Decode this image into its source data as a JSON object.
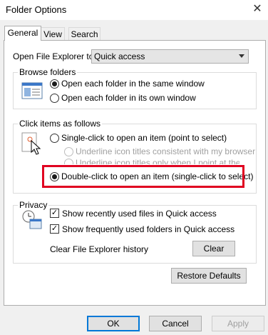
{
  "window": {
    "title": "Folder Options",
    "close_glyph": "✕"
  },
  "tabs": [
    "General",
    "View",
    "Search"
  ],
  "open_explorer": {
    "label": "Open File Explorer to:",
    "value": "Quick access"
  },
  "browse_folders": {
    "label": "Browse folders",
    "options": [
      "Open each folder in the same window",
      "Open each folder in its own window"
    ],
    "selected": 0
  },
  "click_items": {
    "label": "Click items as follows",
    "single_click": "Single-click to open an item (point to select)",
    "underline_consistent": "Underline icon titles consistent with my browser",
    "underline_point": "Underline icon titles only when I point at them",
    "double_click": "Double-click to open an item (single-click to select)",
    "selected": "double_click"
  },
  "privacy": {
    "label": "Privacy",
    "show_recent_files": "Show recently used files in Quick access",
    "show_frequent_folders": "Show frequently used folders in Quick access",
    "clear_history_label": "Clear File Explorer history",
    "clear_button": "Clear"
  },
  "restore_defaults": "Restore Defaults",
  "footer": {
    "ok": "OK",
    "cancel": "Cancel",
    "apply": "Apply"
  },
  "colors": {
    "highlight": "#e00020",
    "accent": "#0078d7"
  }
}
